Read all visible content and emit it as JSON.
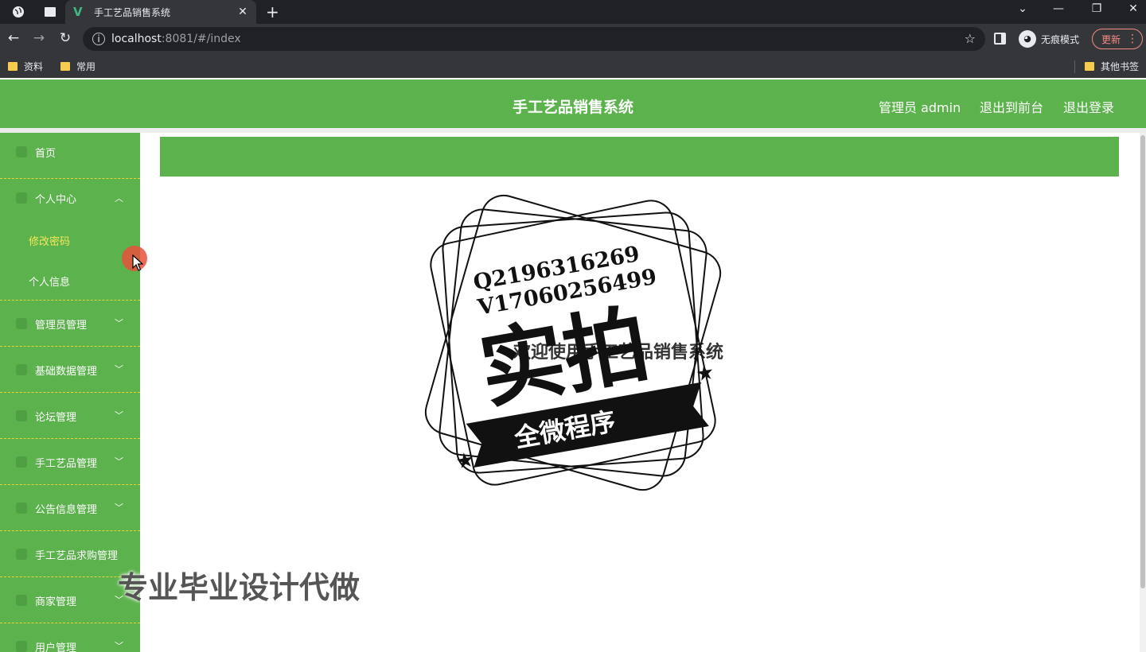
{
  "browser": {
    "tab_title": "手工艺品销售系统",
    "tab_favicon": "V",
    "url_host": "localhost",
    "url_rest": ":8081/#/index",
    "incognito_label": "无痕模式",
    "update_label": "更新",
    "bookmarks": [
      "资料",
      "常用"
    ],
    "other_bookmarks": "其他书签",
    "icons": {
      "globe": "globe-icon",
      "tab_search": "tab-search-icon",
      "back": "back-arrow-icon",
      "forward": "forward-arrow-icon",
      "reload": "reload-icon",
      "star": "star-icon"
    }
  },
  "header": {
    "title": "手工艺品销售系统",
    "user_label": "管理员 admin",
    "exit_front": "退出到前台",
    "logout": "退出登录"
  },
  "sidebar": {
    "items": [
      {
        "label": "首页",
        "icon": "home-icon"
      },
      {
        "label": "个人中心",
        "icon": "user-icon",
        "expanded": true
      },
      {
        "label": "管理员管理",
        "icon": "admin-icon"
      },
      {
        "label": "基础数据管理",
        "icon": "data-icon"
      },
      {
        "label": "论坛管理",
        "icon": "forum-icon"
      },
      {
        "label": "手工艺品管理",
        "icon": "craft-icon"
      },
      {
        "label": "公告信息管理",
        "icon": "notice-icon"
      },
      {
        "label": "手工艺品求购管理",
        "icon": "purchase-icon"
      },
      {
        "label": "商家管理",
        "icon": "shop-icon"
      },
      {
        "label": "用户管理",
        "icon": "users-icon"
      }
    ],
    "submenu": [
      {
        "label": "修改密码",
        "active": true
      },
      {
        "label": "个人信息",
        "active": false
      }
    ]
  },
  "main": {
    "welcome": "欢迎使用手工艺品销售系统"
  },
  "overlay": {
    "stamp_qq": "Q2196316269",
    "stamp_wx": "V17060256499",
    "stamp_big": "实拍",
    "stamp_ribbon": "全微程序",
    "watermark": "专业毕业设计代做"
  },
  "colors": {
    "brand_green": "#5cb24d",
    "active_submenu": "#f5e85a",
    "menu_divider": "#e8d43a"
  }
}
